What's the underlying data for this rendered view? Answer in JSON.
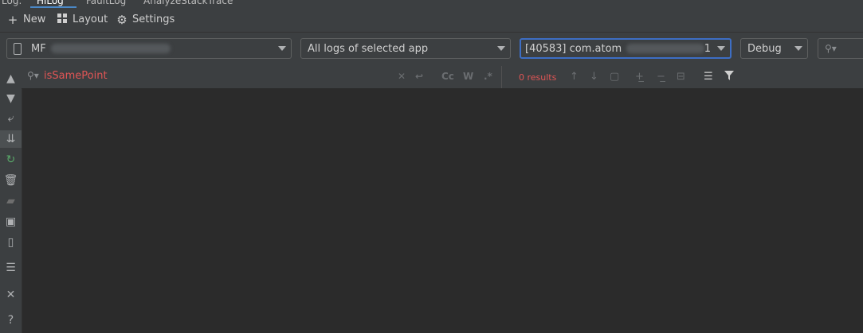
{
  "tabs": [
    "Log:",
    "HiLog",
    "FaultLog",
    "AnalyzeStackTrace"
  ],
  "toolbar": {
    "new_label": "New",
    "layout_label": "Layout",
    "settings_label": "Settings"
  },
  "filters": {
    "device_prefix": "MF",
    "device_mid": "…",
    "log_scope": "All logs of selected app",
    "process": "[40583] com.atom",
    "process_suffix": "1",
    "level": "Debug",
    "search_placeholder": ""
  },
  "search": {
    "query": "isSamePoint",
    "cc_label": "Cc",
    "w_label": "W",
    "regex_label": ".*",
    "results_label": "0 results"
  },
  "icons": {
    "new": "plus-icon",
    "layout": "grid-icon",
    "settings": "gear-icon",
    "filter": "funnel-icon"
  },
  "colors": {
    "accent": "#3d6ec5",
    "error_text": "#e05555",
    "background": "#2b2b2b",
    "panel": "#3c3f41"
  }
}
